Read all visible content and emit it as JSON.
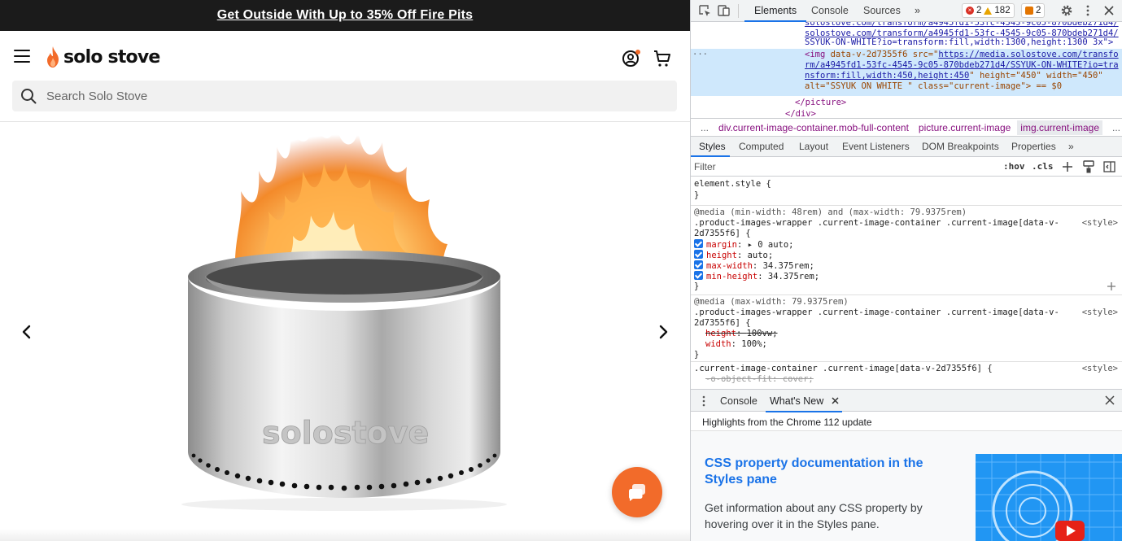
{
  "site": {
    "promo_text": "Get Outside With Up to 35% Off Fire Pits",
    "brand_name": "solo stove",
    "search_placeholder": "Search Solo Stove",
    "product_engraving": "solostove",
    "accent_color": "#f26b2a"
  },
  "devtools": {
    "tabs": [
      "Elements",
      "Console",
      "Sources",
      "»"
    ],
    "error_count": "2",
    "warning_count": "182",
    "issue_count": "2",
    "dom_lines": {
      "line1_url": "solostove.com/transform/a4945fd1-53fc-4545-9c05-870bdeb271d4/",
      "line2": "SSYUK-ON-WHITE?io=transform:fill,width:1300,height:1300 3x\">",
      "img_open": "<img ",
      "img_attr1": "data-v-2d7355f6",
      "img_src_label": " src=\"",
      "img_src_1": "https://media.solostove.com/transfo",
      "img_src_2": "rm/a4945fd1-53fc-4545-9c05-870bdeb271d4/SSYUK-ON-WHITE?io=tra",
      "img_src_3": "nsform:fill,width:450,height:450",
      "img_height_attr": "\" height=\"450\" width=\"450\"",
      "img_alt": "alt=\"SSYUK ON WHITE \" class=\"current-image\"> == $0",
      "picture_close": "</picture>",
      "div_close": "</div>"
    },
    "breadcrumbs": [
      "...",
      "div.current-image-container.mob-full-content",
      "picture.current-image",
      "img.current-image",
      "..."
    ],
    "subtabs": [
      "Styles",
      "Computed",
      "Layout",
      "Event Listeners",
      "DOM Breakpoints",
      "Properties",
      "»"
    ],
    "filter_placeholder": "Filter",
    "filter_hov": ":hov",
    "filter_cls": ".cls",
    "styles": {
      "element_style": "element.style {",
      "close_brace": "}",
      "rule1_media": "@media (min-width: 48rem) and (max-width: 79.9375rem)",
      "rule1_sel1": ".product-images-wrapper .current-image-container .current-image[data-v-",
      "rule1_sel2": "2d7355f6] {",
      "rule1_props": [
        {
          "name": "margin",
          "value": "▸ 0 auto;"
        },
        {
          "name": "height",
          "value": "auto;"
        },
        {
          "name": "max-width",
          "value": "34.375rem;"
        },
        {
          "name": "min-height",
          "value": "34.375rem;"
        }
      ],
      "source": "<style>",
      "rule2_media": "@media (max-width: 79.9375rem)",
      "rule2_sel1": ".product-images-wrapper .current-image-container .current-image[data-v-",
      "rule2_sel2": "2d7355f6] {",
      "rule2_props": [
        {
          "name": "height",
          "value": "100vw;"
        },
        {
          "name": "width",
          "value": "100%;"
        }
      ],
      "rule3_sel": ".current-image-container .current-image[data-v-2d7355f6] {",
      "rule3_prop": "-o-object-fit: cover;"
    },
    "drawer": {
      "tabs": [
        "Console",
        "What's New"
      ],
      "subtitle": "Highlights from the Chrome 112 update",
      "card_title": "CSS property documentation in the Styles pane",
      "card_desc": "Get information about any CSS property by hovering over it in the Styles pane."
    },
    "link_color": "#1a73e8"
  }
}
